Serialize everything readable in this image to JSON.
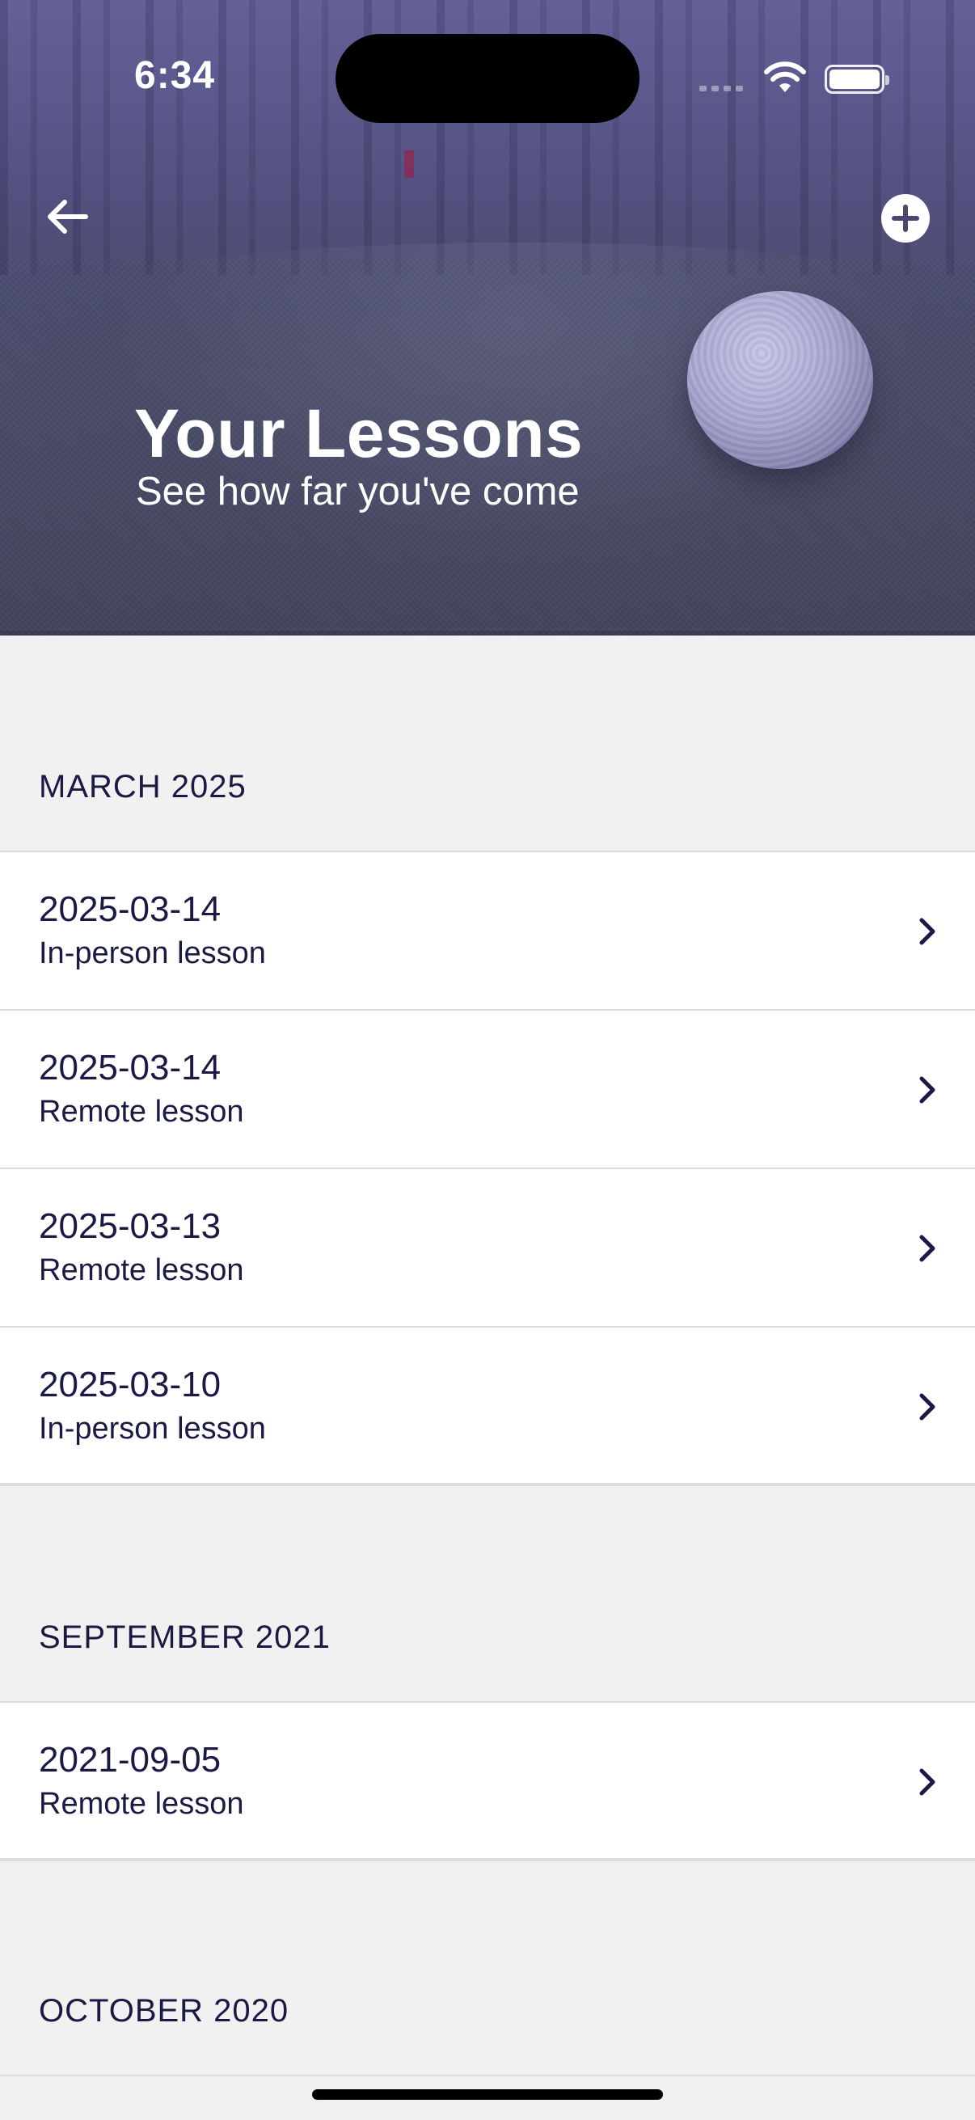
{
  "status_bar": {
    "time": "6:34"
  },
  "header": {
    "title": "Your Lessons",
    "subtitle": "See how far you've come",
    "back_icon": "arrow-left-icon",
    "add_icon": "plus-circle-icon"
  },
  "sections": [
    {
      "title": "MARCH 2025",
      "lessons": [
        {
          "date": "2025-03-14",
          "type": "In-person lesson"
        },
        {
          "date": "2025-03-14",
          "type": "Remote lesson"
        },
        {
          "date": "2025-03-13",
          "type": "Remote lesson"
        },
        {
          "date": "2025-03-10",
          "type": "In-person lesson"
        }
      ]
    },
    {
      "title": "SEPTEMBER 2021",
      "lessons": [
        {
          "date": "2021-09-05",
          "type": "Remote lesson"
        }
      ]
    },
    {
      "title": "OCTOBER 2020",
      "lessons": []
    }
  ],
  "colors": {
    "text": "#1b1a45",
    "background": "#f1f1f1",
    "row_background": "#ffffff",
    "hero_tint": "#5c5896"
  }
}
